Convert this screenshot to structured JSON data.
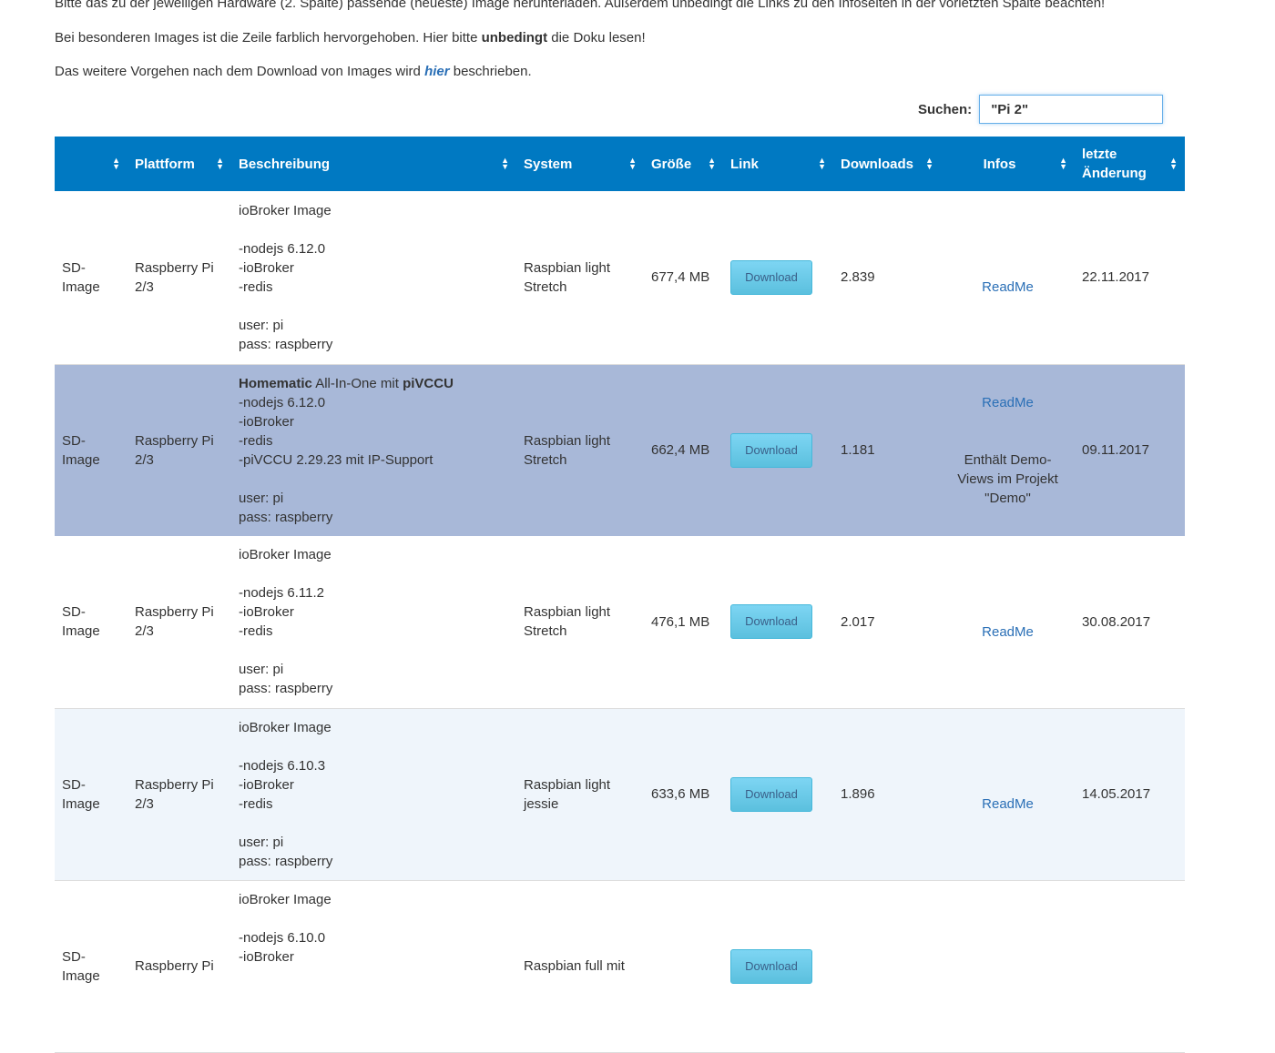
{
  "intro": {
    "line1": "Bitte das zu der jeweiligen Hardware (2. Spalte) passende (neueste) Image herunterladen. Außerdem unbedingt die Links zu den Infoseiten in der vorletzten Spalte beachten!",
    "line2_pre": "Bei besonderen Images ist die Zeile farblich hervorgehoben. Hier bitte ",
    "line2_bold": "unbedingt",
    "line2_post": " die Doku lesen!",
    "line3_pre": "Das weitere Vorgehen nach dem Download von Images wird ",
    "line3_link": "hier",
    "line3_post": " beschrieben."
  },
  "search": {
    "label": "Suchen:",
    "value": "\"Pi 2\""
  },
  "table": {
    "headers": [
      "",
      "Plattform",
      "Beschreibung",
      "System",
      "Größe",
      "Link",
      "Downloads",
      "Infos",
      "letzte Änderung"
    ],
    "rows": [
      {
        "type": "SD-Image",
        "platform": "Raspberry Pi 2/3",
        "desc": [
          "ioBroker Image",
          "",
          "-nodejs 6.12.0",
          "-ioBroker",
          "-redis",
          "",
          "user: pi",
          "pass: raspberry"
        ],
        "system": "Raspbian light Stretch",
        "size": "677,4 MB",
        "link": "Download",
        "downloads": "2.839",
        "info_link": "ReadMe",
        "info_text": "",
        "date": "22.11.2017"
      },
      {
        "type": "SD-Image",
        "platform": "Raspberry Pi 2/3",
        "desc_first_bold": "Homematic",
        "desc_first_mid": " All-In-One mit ",
        "desc_first_bold2": "piVCCU",
        "desc": [
          "-nodejs 6.12.0",
          "-ioBroker",
          "-redis",
          "-piVCCU 2.29.23 mit IP-Support",
          "",
          "user: pi",
          "pass: raspberry"
        ],
        "system": "Raspbian light Stretch",
        "size": "662,4 MB",
        "link": "Download",
        "downloads": "1.181",
        "info_link": "ReadMe",
        "info_text": "Enthält Demo-Views im Projekt \"Demo\"",
        "date": "09.11.2017"
      },
      {
        "type": "SD-Image",
        "platform": "Raspberry Pi 2/3",
        "desc": [
          "ioBroker Image",
          "",
          "-nodejs 6.11.2",
          "-ioBroker",
          "-redis",
          "",
          "user: pi",
          "pass: raspberry"
        ],
        "system": "Raspbian light Stretch",
        "size": "476,1 MB",
        "link": "Download",
        "downloads": "2.017",
        "info_link": "ReadMe",
        "info_text": "",
        "date": "30.08.2017"
      },
      {
        "type": "SD-Image",
        "platform": "Raspberry Pi 2/3",
        "desc": [
          "ioBroker Image",
          "",
          "-nodejs 6.10.3",
          "-ioBroker",
          "-redis",
          "",
          "user: pi",
          "pass: raspberry"
        ],
        "system": "Raspbian light jessie",
        "size": "633,6 MB",
        "link": "Download",
        "downloads": "1.896",
        "info_link": "ReadMe",
        "info_text": "",
        "date": "14.05.2017"
      },
      {
        "type": "SD-Image",
        "platform": "Raspberry Pi",
        "desc": [
          "ioBroker Image",
          "",
          "-nodejs 6.10.0",
          "-ioBroker"
        ],
        "system": "Raspbian full mit",
        "link": "Download"
      }
    ]
  }
}
